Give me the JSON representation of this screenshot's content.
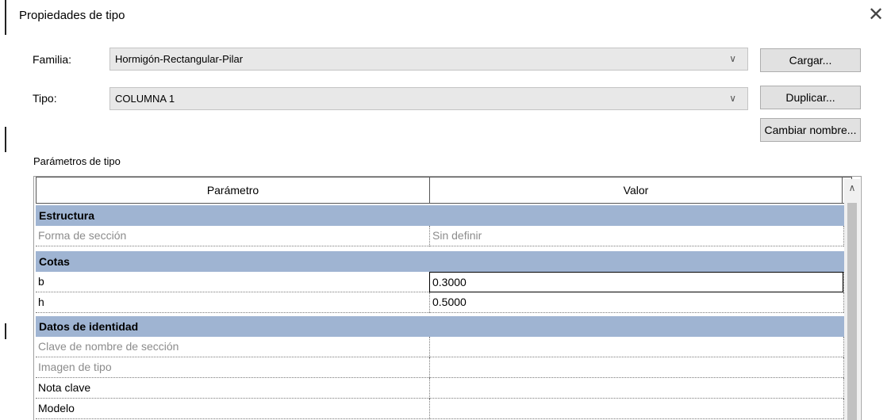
{
  "dialog": {
    "title": "Propiedades de tipo",
    "close_glyph": "✕"
  },
  "family": {
    "label": "Familia:",
    "value": "Hormigón-Rectangular-Pilar"
  },
  "type": {
    "label": "Tipo:",
    "value": "COLUMNA 1"
  },
  "buttons": {
    "load": "Cargar...",
    "duplicate": "Duplicar...",
    "rename": "Cambiar nombre..."
  },
  "section_label": "Parámetros de tipo",
  "grid": {
    "headers": {
      "param": "Parámetro",
      "value": "Valor",
      "eq": "="
    },
    "groups": [
      {
        "name": "Estructura",
        "rows": [
          {
            "param": "Forma de sección",
            "value": "Sin definir"
          }
        ]
      },
      {
        "name": "Cotas",
        "rows": [
          {
            "param": "b",
            "value": "0.3000"
          },
          {
            "param": "h",
            "value": "0.5000"
          }
        ]
      },
      {
        "name": "Datos de identidad",
        "rows": [
          {
            "param": "Clave de nombre de sección",
            "value": ""
          },
          {
            "param": "Imagen de tipo",
            "value": ""
          },
          {
            "param": "Nota clave",
            "value": ""
          },
          {
            "param": "Modelo",
            "value": ""
          }
        ]
      }
    ]
  },
  "icons": {
    "chevron": "chevron-down-icon",
    "collapse": "collapse-icon",
    "scroll_up": "scroll-up-icon"
  },
  "glyphs": {
    "chevron": "∨",
    "collapse": "⌃",
    "scroll_up": "∧"
  },
  "colors": {
    "group_header": "#9fb4d2",
    "dim_text": "#8c8c8c"
  }
}
